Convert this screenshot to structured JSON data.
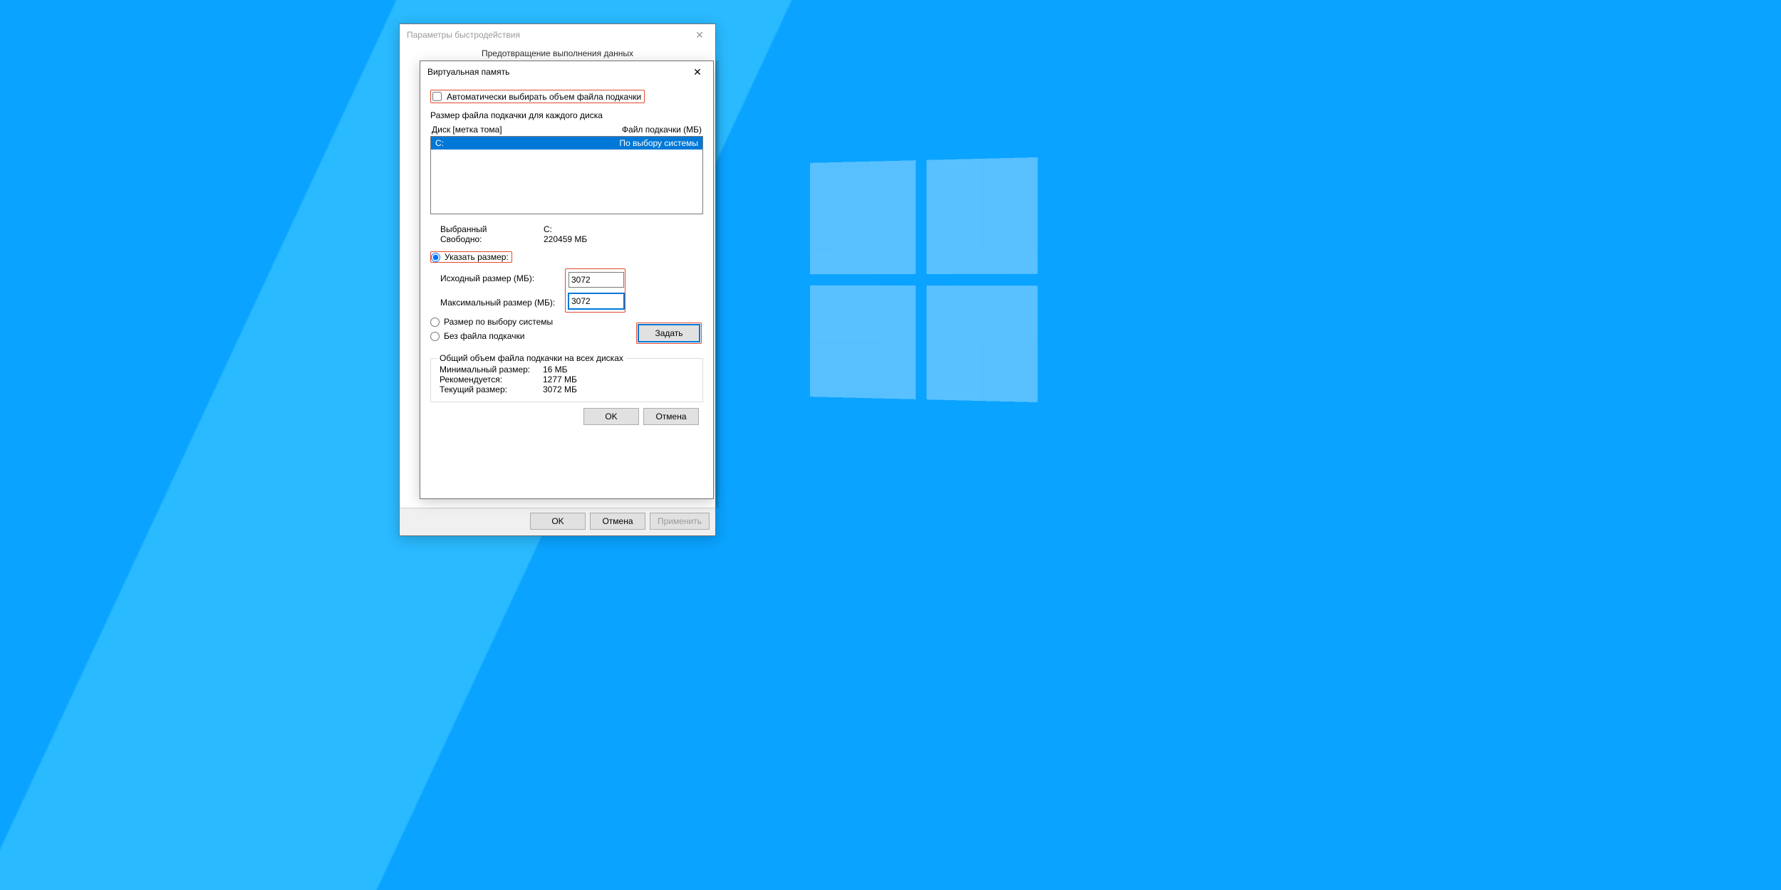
{
  "parent_window": {
    "title": "Параметры быстродействия",
    "tab_dep": "Предотвращение выполнения данных",
    "ok": "OK",
    "cancel": "Отмена",
    "apply": "Применить"
  },
  "vm": {
    "title": "Виртуальная память",
    "auto_checkbox": "Автоматически выбирать объем файла подкачки",
    "per_drive_label": "Размер файла подкачки для каждого диска",
    "col_drive": "Диск [метка тома]",
    "col_pagefile": "Файл подкачки (МБ)",
    "drives": [
      {
        "letter": "C:",
        "pagefile": "По выбору системы"
      }
    ],
    "selected_label": "Выбранный",
    "selected_value": "C:",
    "free_label": "Свободно:",
    "free_value": "220459 МБ",
    "radio_custom": "Указать размер:",
    "initial_label": "Исходный размер (МБ):",
    "initial_value": "3072",
    "max_label": "Максимальный размер (МБ):",
    "max_value": "3072",
    "radio_system": "Размер по выбору системы",
    "radio_none": "Без файла подкачки",
    "set_btn": "Задать",
    "totals_title": "Общий объем файла подкачки на всех дисках",
    "min_label": "Минимальный размер:",
    "min_value": "16 МБ",
    "rec_label": "Рекомендуется:",
    "rec_value": "1277 МБ",
    "cur_label": "Текущий размер:",
    "cur_value": "3072 МБ",
    "ok": "OK",
    "cancel": "Отмена"
  }
}
